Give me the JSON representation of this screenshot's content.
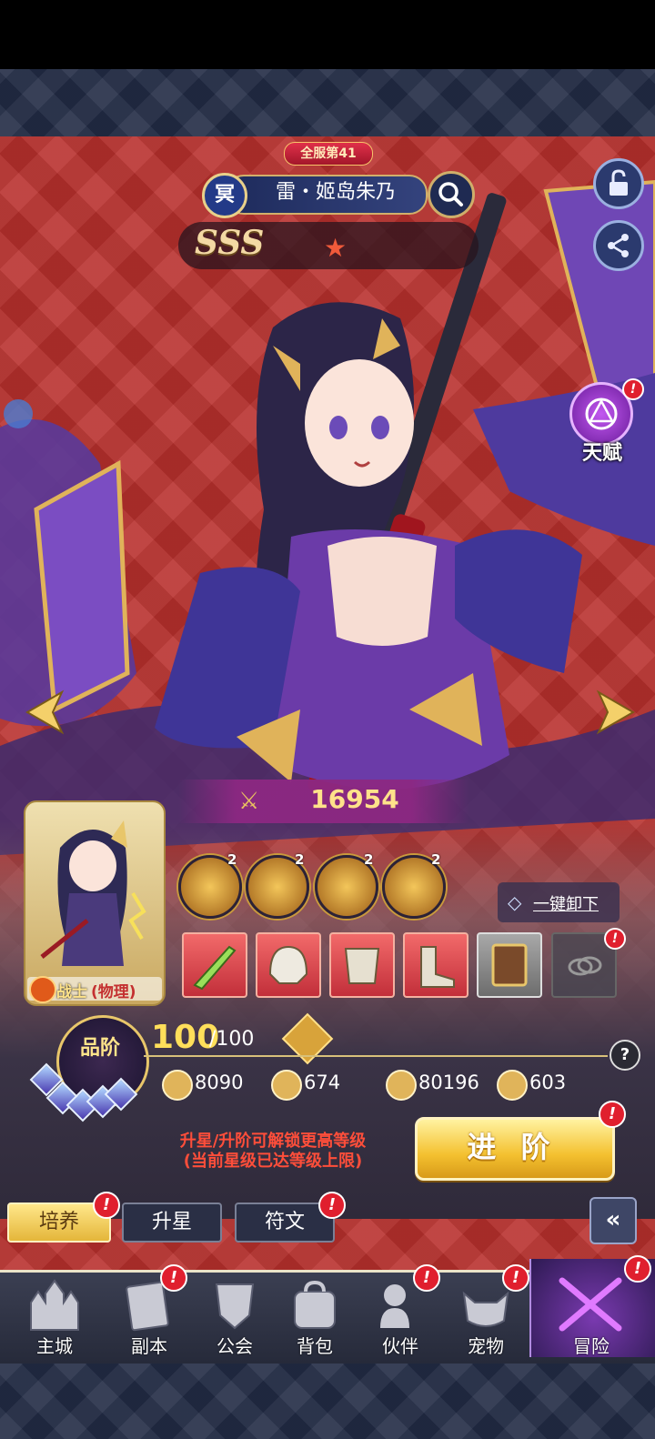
{
  "header": {
    "server_rank": "全服第41",
    "faction": "冥",
    "hero_name": "雷・姬岛朱乃",
    "grade": "SSS"
  },
  "side": {
    "talent_label": "天赋"
  },
  "power": {
    "value": "16954"
  },
  "hero_card": {
    "class_main": "战士",
    "class_sub": "(物理)"
  },
  "skills": [
    {
      "level": "2"
    },
    {
      "level": "2"
    },
    {
      "level": "2"
    },
    {
      "level": "2"
    }
  ],
  "equipment": {
    "unequip_label": "一键卸下"
  },
  "grade_panel": {
    "label": "品阶",
    "level_current": "100",
    "level_max": "/100"
  },
  "stats": [
    {
      "icon": "attack-icon",
      "value": "8090"
    },
    {
      "icon": "defense-icon",
      "value": "674"
    },
    {
      "icon": "hp-icon",
      "value": "80196"
    },
    {
      "icon": "speed-icon",
      "value": "603"
    }
  ],
  "hint": {
    "line1": "升星/升阶可解锁更高等级",
    "line2": "(当前星级已达等级上限)"
  },
  "advance_button": "进 阶",
  "tabs": [
    {
      "label": "培养"
    },
    {
      "label": "升星"
    },
    {
      "label": "符文"
    }
  ],
  "alert_mark": "!",
  "help_mark": "?",
  "collapse_mark": "«",
  "bottom_nav": [
    {
      "label": "主城"
    },
    {
      "label": "副本"
    },
    {
      "label": "公会"
    },
    {
      "label": "背包"
    },
    {
      "label": "伙伴"
    },
    {
      "label": "宠物"
    },
    {
      "label": "冒险"
    }
  ]
}
